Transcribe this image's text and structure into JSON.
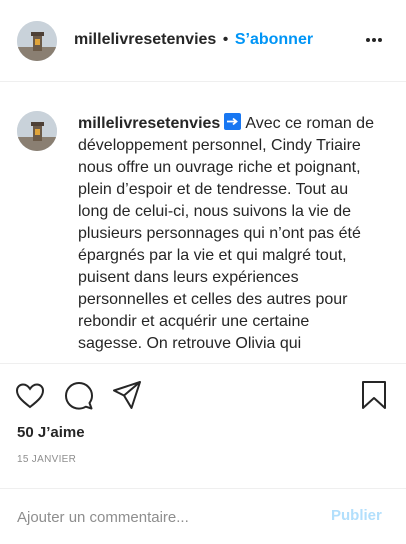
{
  "header": {
    "username": "millelivresetenvies",
    "separator": "•",
    "follow_label": "S’abonner",
    "more_icon": "more-horizontal-icon"
  },
  "post": {
    "caption_user": "millelivresetenvies",
    "emoji": "right-arrow-emoji",
    "caption_text": "Avec ce roman de développement personnel, Cindy Triaire nous offre un ouvrage riche et poignant, plein d’espoir et de tendresse. Tout au long de celui-ci, nous suivons la vie de plusieurs personnages qui n’ont pas été épargnés par la vie et qui malgré tout, puisent dans leurs expériences personnelles et celles des autres pour rebondir et acquérir une certaine sagesse. On retrouve Olivia qui",
    "likes": "50 J’aime",
    "date": "15 JANVIER"
  },
  "comment_bar": {
    "placeholder": "Ajouter un commentaire...",
    "publish_label": "Publier"
  },
  "colors": {
    "accent": "#0095f6",
    "publish_disabled": "#b2dffc",
    "muted": "#8e8e8e"
  }
}
